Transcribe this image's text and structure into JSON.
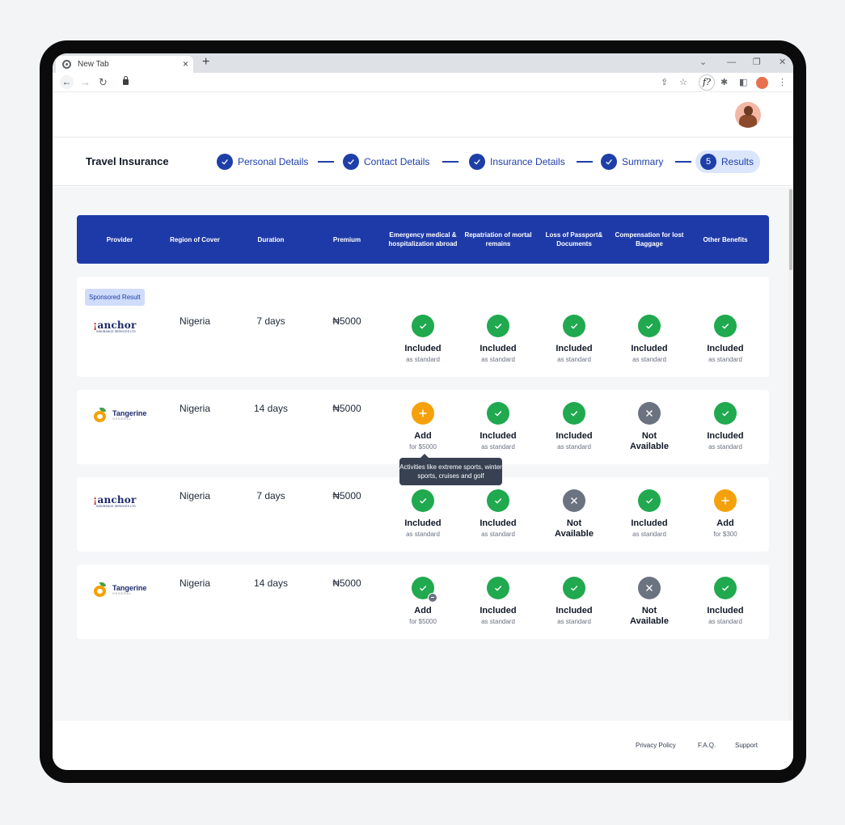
{
  "browser": {
    "tab_title": "New Tab",
    "tab_close": "×",
    "new_tab": "+",
    "win_min": "—",
    "win_restore": "❐",
    "win_close": "✕",
    "win_chevron": "⌄",
    "ext_label": "f?"
  },
  "header": {
    "title": "Travel Insurance"
  },
  "stepper": {
    "steps": [
      {
        "label": "Personal Details"
      },
      {
        "label": "Contact Details"
      },
      {
        "label": "Insurance Details"
      },
      {
        "label": "Summary"
      },
      {
        "label": "Results",
        "number": "5"
      }
    ]
  },
  "table": {
    "columns": [
      "Provider",
      "Region of Cover",
      "Duration",
      "Premium",
      "Emergency medical & hospitalization abroad",
      "Repatriation of mortal remains",
      "Loss of Passport& Documents",
      "Compensation for lost Baggage",
      "Other Benefits"
    ],
    "rows": [
      {
        "sponsored": "Sponsored Result",
        "provider_name": "anchor",
        "provider_sub": "INSURANCE SERVICES LTD",
        "region": "Nigeria",
        "duration": "7 days",
        "premium": "₦5000",
        "benefits": [
          {
            "title": "Included",
            "sub": "as standard"
          },
          {
            "title": "Included",
            "sub": "as standard"
          },
          {
            "title": "Included",
            "sub": "as standard"
          },
          {
            "title": "Included",
            "sub": "as standard"
          },
          {
            "title": "Included",
            "sub": "as standard"
          }
        ]
      },
      {
        "provider_name": "Tangerine",
        "provider_sub": "GENERAL",
        "region": "Nigeria",
        "duration": "14 days",
        "premium": "₦5000",
        "benefits": [
          {
            "title": "Add",
            "sub": "for $5000"
          },
          {
            "title": "Included",
            "sub": "as standard"
          },
          {
            "title": "Included",
            "sub": "as standard"
          },
          {
            "title": "Not Available",
            "sub": ""
          },
          {
            "title": "Included",
            "sub": "as standard"
          }
        ]
      },
      {
        "provider_name": "anchor",
        "provider_sub": "INSURANCE SERVICES LTD",
        "region": "Nigeria",
        "duration": "7 days",
        "premium": "₦5000",
        "benefits": [
          {
            "title": "Included",
            "sub": "as standard"
          },
          {
            "title": "Included",
            "sub": "as standard"
          },
          {
            "title": "Not Available",
            "sub": ""
          },
          {
            "title": "Included",
            "sub": "as standard"
          },
          {
            "title": "Add",
            "sub": "for $300"
          }
        ]
      },
      {
        "provider_name": "Tangerine",
        "provider_sub": "GENERAL",
        "region": "Nigeria",
        "duration": "14 days",
        "premium": "₦5000",
        "benefits": [
          {
            "title": "Add",
            "sub": "for $5000"
          },
          {
            "title": "Included",
            "sub": "as standard"
          },
          {
            "title": "Included",
            "sub": "as standard"
          },
          {
            "title": "Not Available",
            "sub": ""
          },
          {
            "title": "Included",
            "sub": "as standard"
          }
        ]
      }
    ]
  },
  "tooltip": {
    "text": "Activities like extreme sports, winter sports, cruises and golf"
  },
  "footer": {
    "links": [
      "Privacy Policy",
      "F.A.Q.",
      "Support"
    ]
  },
  "colors": {
    "primary": "#1e3aa8",
    "included": "#20a94f",
    "add": "#f5a10c",
    "not_available": "#6b7280"
  }
}
